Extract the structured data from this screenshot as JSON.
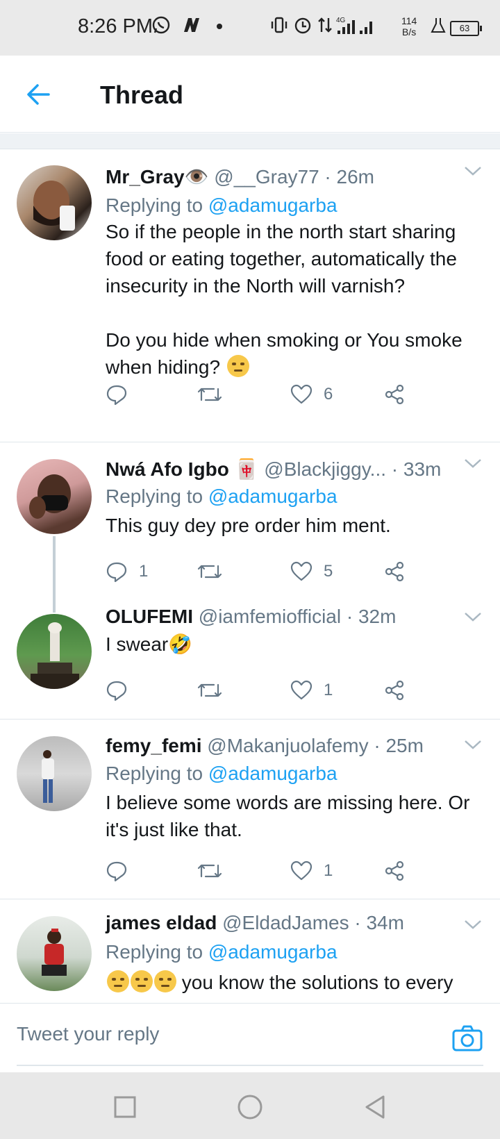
{
  "status_bar": {
    "time": "8:26 PM",
    "net_speed_value": "114",
    "net_speed_unit": "B/s",
    "battery": "63",
    "network": "4G"
  },
  "header": {
    "title": "Thread"
  },
  "tweets": [
    {
      "name": "Mr_Gray👁️",
      "handle": "@__Gray77 · 26m",
      "replying_prefix": "Replying to ",
      "replying_to": "@adamugarba",
      "body": "So if the people in the north start sharing food or eating together, automatically the insecurity in the North will varnish?\n\nDo you hide when smoking or You smoke when hiding?",
      "reply_count": "",
      "retweet_count": "",
      "like_count": "6"
    },
    {
      "name": "Nwá Afo Igbo 🀄",
      "handle": "@Blackjiggy...  · 33m",
      "replying_prefix": "Replying to ",
      "replying_to": "@adamugarba",
      "body": "This guy dey pre order him ment.",
      "reply_count": "1",
      "retweet_count": "",
      "like_count": "5"
    },
    {
      "name": "OLUFEMI",
      "handle": "@iamfemiofficial · 32m",
      "body": "I swear🤣",
      "reply_count": "",
      "retweet_count": "",
      "like_count": "1"
    },
    {
      "name": "femy_femi",
      "handle": "@Makanjuolafemy · 25m",
      "replying_prefix": "Replying to ",
      "replying_to": "@adamugarba",
      "body": "I believe some words are missing here. Or it's just like that.",
      "reply_count": "",
      "retweet_count": "",
      "like_count": "1"
    },
    {
      "name": "james eldad",
      "handle": "@EldadJames · 34m",
      "replying_prefix": "Replying to ",
      "replying_to": "@adamugarba",
      "body": " you know the solutions to every"
    }
  ],
  "compose": {
    "placeholder": "Tweet your reply"
  },
  "colors": {
    "accent": "#1da1f2",
    "secondary_text": "#657786",
    "primary_text": "#14171a"
  }
}
